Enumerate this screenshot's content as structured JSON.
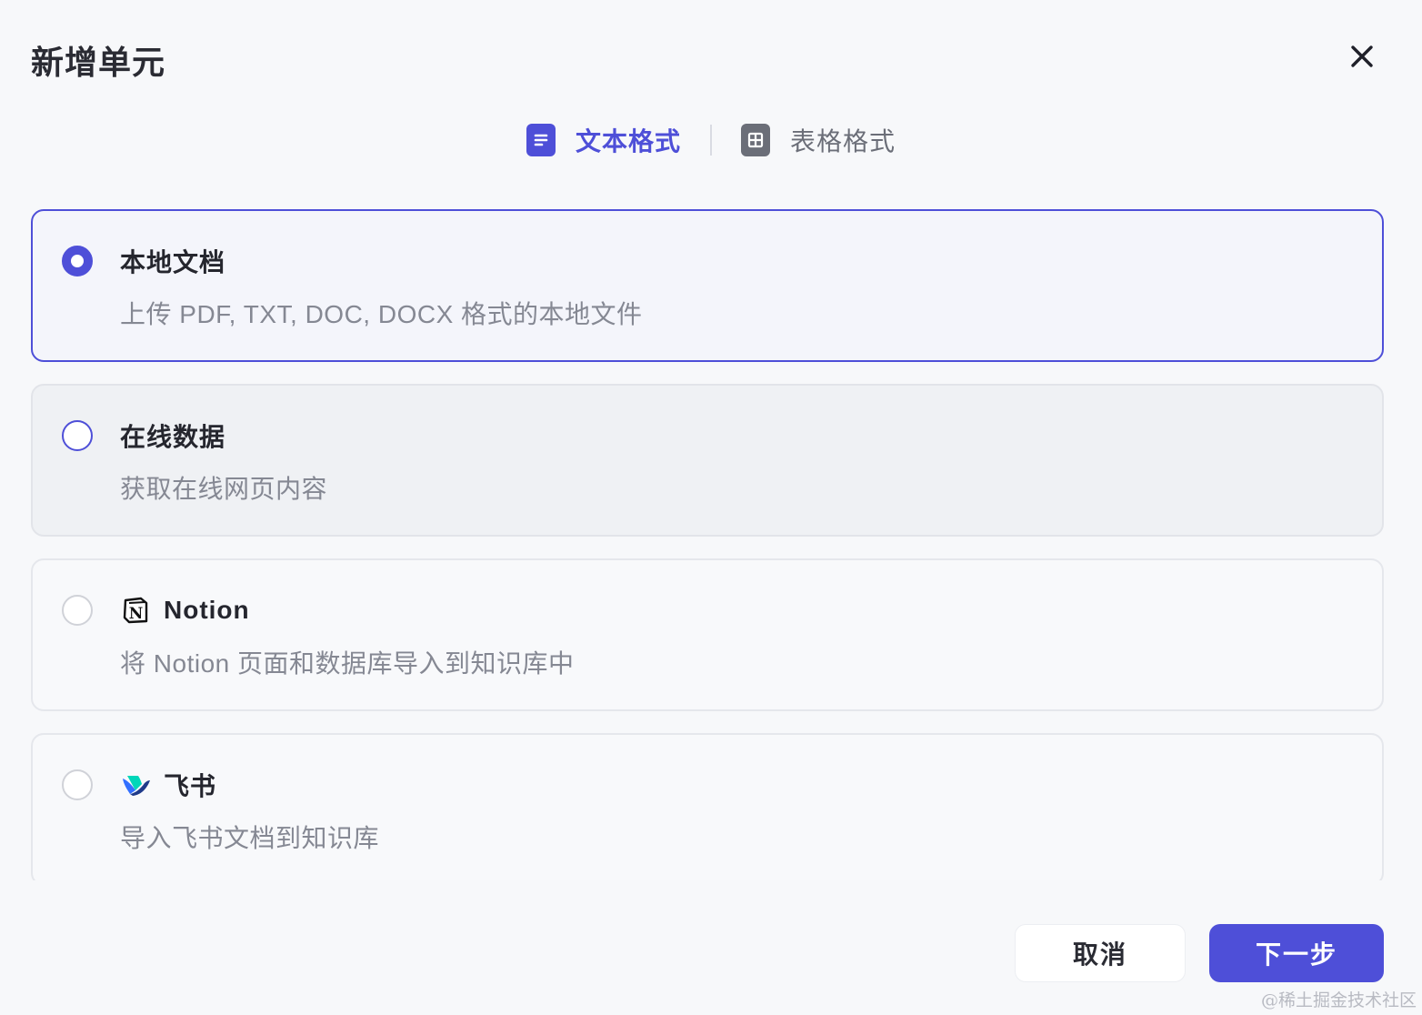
{
  "dialog": {
    "title": "新增单元"
  },
  "tabs": [
    {
      "label": "文本格式",
      "icon": "document-icon",
      "active": true
    },
    {
      "label": "表格格式",
      "icon": "table-icon",
      "active": false
    }
  ],
  "options": [
    {
      "title": "本地文档",
      "description": "上传 PDF, TXT, DOC, DOCX 格式的本地文件",
      "selected": true,
      "logo": null
    },
    {
      "title": "在线数据",
      "description": "获取在线网页内容",
      "selected": false,
      "logo": null
    },
    {
      "title": "Notion",
      "description": "将 Notion 页面和数据库导入到知识库中",
      "selected": false,
      "logo": "notion-logo"
    },
    {
      "title": "飞书",
      "description": "导入飞书文档到知识库",
      "selected": false,
      "logo": "feishu-logo"
    }
  ],
  "footer": {
    "cancel_label": "取消",
    "next_label": "下一步"
  },
  "watermark": "@稀土掘金技术社区",
  "colors": {
    "accent": "#4e4fd8",
    "background": "#f7f8fa",
    "border": "#e5e7ec",
    "muted_text": "#858893"
  }
}
